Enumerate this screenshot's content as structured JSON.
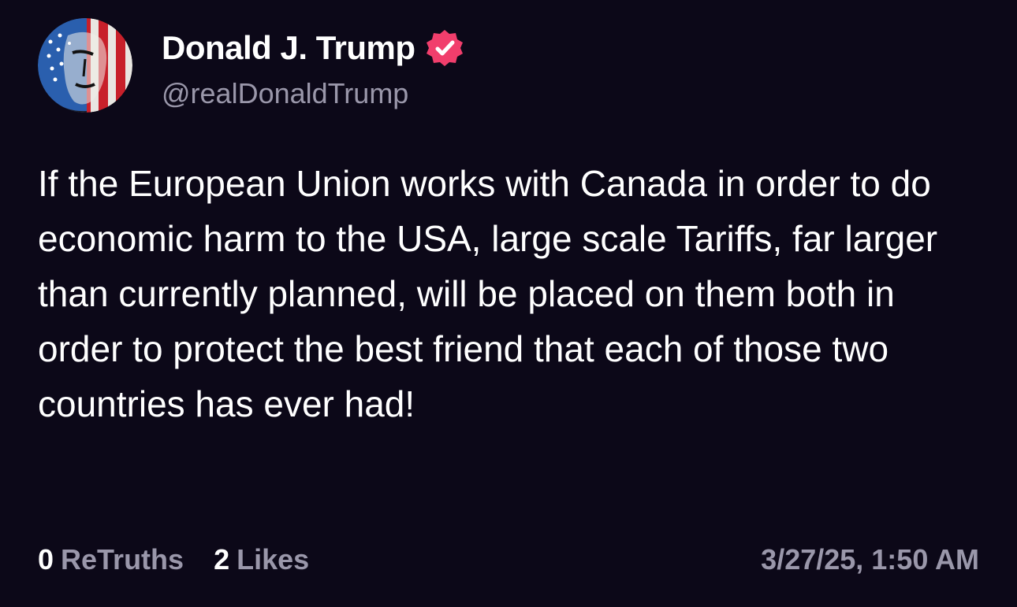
{
  "author": {
    "display_name": "Donald J. Trump",
    "handle": "@realDonaldTrump",
    "avatar_icon": "flag-portrait-avatar",
    "verified_icon": "verified-badge-icon",
    "verified_color": "#f13e6c"
  },
  "post": {
    "text": "If the European Union works with Canada in order to do economic harm to the USA, large scale Tariffs, far larger than currently planned, will be placed on them both in order to protect the best friend that each of those two countries has ever had!"
  },
  "stats": {
    "retruths_count": "0",
    "retruths_label": "ReTruths",
    "likes_count": "2",
    "likes_label": "Likes"
  },
  "timestamp": "3/27/25, 1:50 AM",
  "colors": {
    "background": "#0c0818",
    "primary_text": "#ffffff",
    "secondary_text": "#9a97aa"
  }
}
